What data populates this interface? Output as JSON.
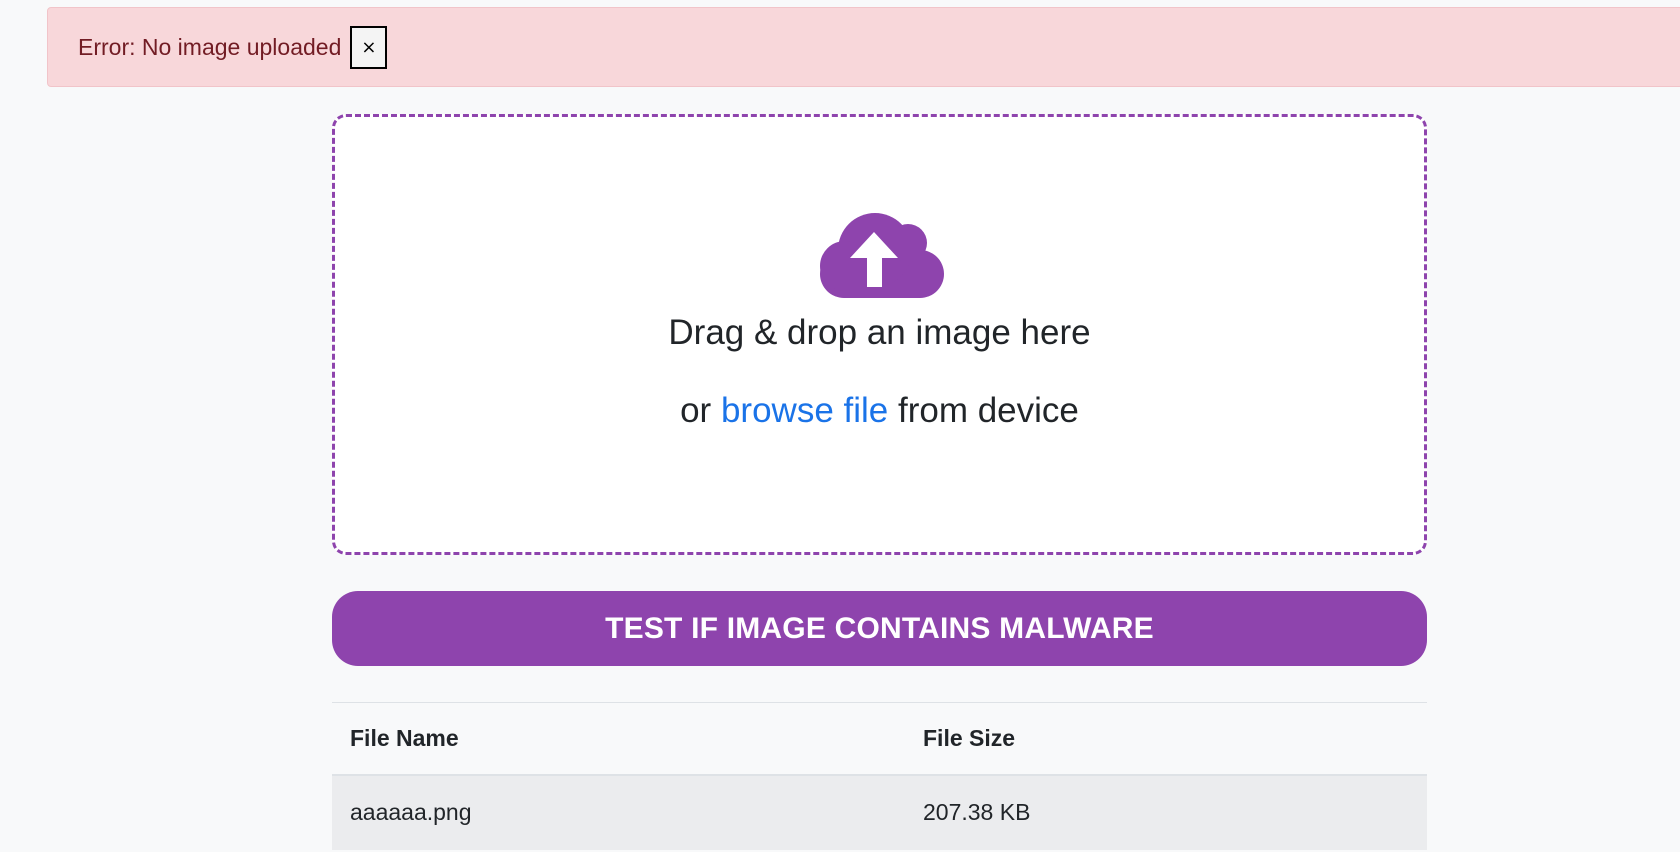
{
  "alert": {
    "message": "Error: No image uploaded",
    "close_label": "×"
  },
  "dropzone": {
    "icon": "cloud-upload-icon",
    "drag_text": "Drag & drop an image here",
    "or_text": "or",
    "browse_link": "browse file",
    "from_text": "from device"
  },
  "actions": {
    "test_label": "TEST IF IMAGE CONTAINS MALWARE"
  },
  "table": {
    "columns": [
      "File Name",
      "File Size"
    ],
    "rows": [
      [
        "aaaaaa.png",
        "207.38 KB"
      ]
    ]
  },
  "colors": {
    "accent": "#8e44ad",
    "link": "#1a73e8",
    "alert_bg": "#f8d7da",
    "alert_text": "#721c24"
  }
}
